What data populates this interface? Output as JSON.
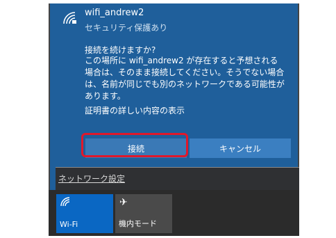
{
  "network": {
    "name": "wifi_andrew2",
    "status": "セキュリティ保護あり"
  },
  "dialog": {
    "question": "接続を続けますか?",
    "message": "この場所に wifi_andrew2 が存在すると予想される場合は、そのまま接続してください。そうでない場合は、名前が同じでも別のネットワークである可能性があります。",
    "cert_link": "証明書の詳しい内容の表示"
  },
  "buttons": {
    "connect": "接続",
    "cancel": "キャンセル"
  },
  "network_settings": "ネットワーク設定",
  "tiles": {
    "wifi": "Wi-Fi",
    "airplane": "機内モード"
  },
  "colors": {
    "panel_bg": "#1f5f9b",
    "button": "#3b7fc1",
    "highlight": "#e0182b",
    "tile_active": "#0a67c3"
  }
}
